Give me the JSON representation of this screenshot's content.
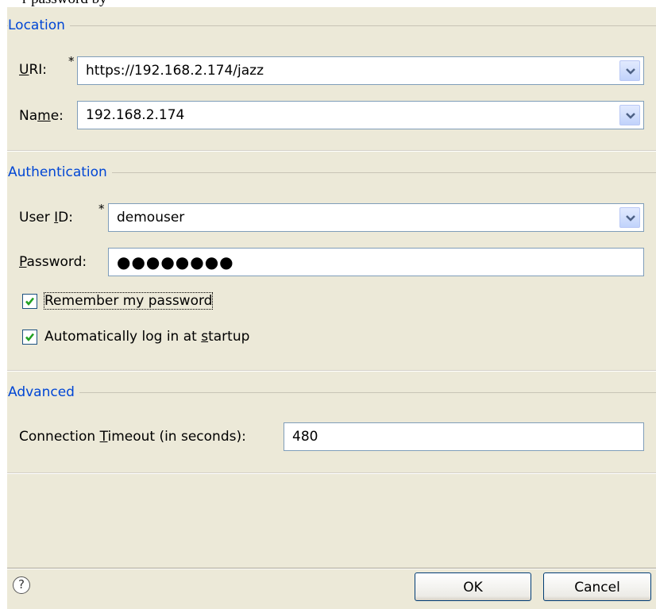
{
  "top_fragment": "r password by",
  "location": {
    "title": "Location",
    "uri_label_prefix": "",
    "uri_mnemonic": "U",
    "uri_label_suffix": "RI:",
    "uri_required": "*",
    "uri_value": "https://192.168.2.174/jazz",
    "name_label_prefix": "Na",
    "name_mnemonic": "m",
    "name_label_suffix": "e:",
    "name_value": "192.168.2.174"
  },
  "authentication": {
    "title": "Authentication",
    "userid_label_prefix": "User ",
    "userid_mnemonic": "I",
    "userid_label_suffix": "D:",
    "userid_required": "*",
    "userid_value": "demouser",
    "password_label_prefix": "",
    "password_mnemonic": "P",
    "password_label_suffix": "assword:",
    "password_value": "●●●●●●●●",
    "remember_label": "Remember my password",
    "remember_checked": true,
    "autologin_label_prefix": "Automatically log in at ",
    "autologin_mnemonic": "s",
    "autologin_label_suffix": "tartup",
    "autologin_checked": true
  },
  "advanced": {
    "title": "Advanced",
    "timeout_label_prefix": "Connection ",
    "timeout_mnemonic": "T",
    "timeout_label_suffix": "imeout (in seconds):",
    "timeout_value": "480"
  },
  "footer": {
    "help_glyph": "?",
    "ok_label": "OK",
    "cancel_label": "Cancel"
  },
  "icons": {
    "dropdown": "chevron-down-icon",
    "check": "check-icon",
    "help": "help-icon"
  },
  "colors": {
    "section_title": "#0046d5",
    "panel_bg": "#ece9d8",
    "field_border": "#7f9db9",
    "checkbox_check": "#21a121"
  }
}
